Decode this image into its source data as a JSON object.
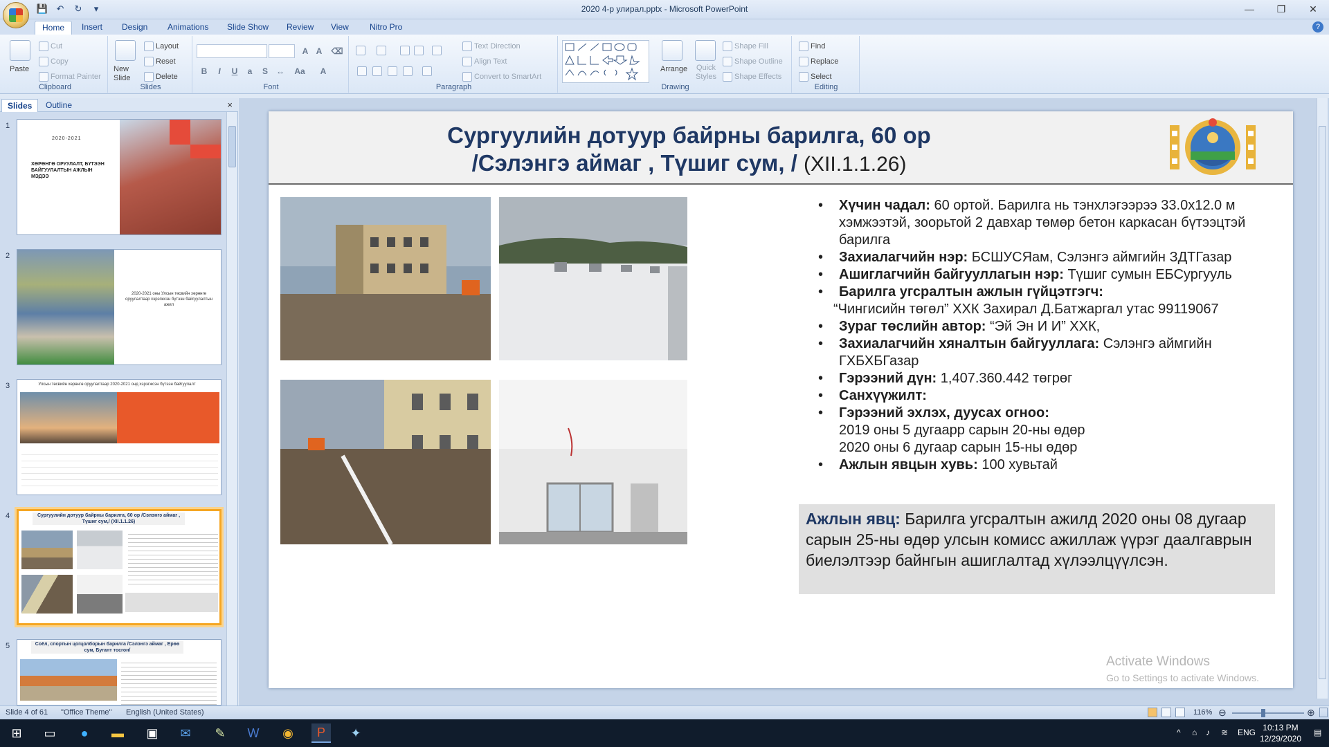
{
  "app": {
    "title": "2020 4-р улирал.pptx - Microsoft PowerPoint",
    "minimize": "—",
    "restore": "❐",
    "close": "✕"
  },
  "tabs": [
    "Home",
    "Insert",
    "Design",
    "Animations",
    "Slide Show",
    "Review",
    "View",
    "Nitro Pro"
  ],
  "ribbon": {
    "clipboard": {
      "label": "Clipboard",
      "paste": "Paste",
      "cut": "Cut",
      "copy": "Copy",
      "format_painter": "Format Painter"
    },
    "slides": {
      "label": "Slides",
      "new_slide": "New Slide",
      "layout": "Layout",
      "reset": "Reset",
      "delete": "Delete"
    },
    "font": {
      "label": "Font"
    },
    "paragraph": {
      "label": "Paragraph",
      "text_direction": "Text Direction",
      "align_text": "Align Text",
      "convert_smartart": "Convert to SmartArt"
    },
    "drawing": {
      "label": "Drawing",
      "arrange": "Arrange",
      "quick_styles": "Quick Styles",
      "shape_fill": "Shape Fill",
      "shape_outline": "Shape Outline",
      "shape_effects": "Shape Effects"
    },
    "editing": {
      "label": "Editing",
      "find": "Find",
      "replace": "Replace",
      "select": "Select"
    }
  },
  "left_pane": {
    "tab_slides": "Slides",
    "tab_outline": "Outline",
    "close": "×",
    "thumbs": [
      {
        "num": "1",
        "year": "2020-2021",
        "text": "ХӨРӨНГӨ ОРУУЛАЛТ, БҮТЭЭН БАЙГУУЛАЛТЫН АЖЛЫН МЭДЭЭ"
      },
      {
        "num": "2",
        "text": "2020-2021 оны Улсын төсвийн хөрөнгө оруулалтаар хэрэгжсэн бүтээн байгуулалтын ажил"
      },
      {
        "num": "3",
        "text": "Улсын төсвийн хөрөнгө оруулалтаар 2020-2021 онд хэрэгжсэн бүтээн байгуулалт"
      },
      {
        "num": "4",
        "title": "Сургуулийн дотуур байрны барилга, 60 ор /Сэлэнгэ аймаг , Түшиг сум,/ (XII.1.1.26)"
      },
      {
        "num": "5",
        "title": "Соёл, спортын цогцолборын барилга /Сэлэнгэ аймаг , Ерөө сум, Бугант тосгон/"
      }
    ]
  },
  "slide": {
    "title_line1": "Сургуулийн дотуур байрны барилга, 60 ор",
    "title_line2": "/Сэлэнгэ аймаг , Түшиг сум, /",
    "title_code": "(XII.1.1.26)",
    "bullets": [
      {
        "label": "Хүчин чадал:",
        "text": " 60 ортой. Барилга нь тэнхлэгээрээ 33.0x12.0 м хэмжээтэй, зоорьтой 2 давхар төмөр бетон каркасан бүтээцтэй барилга"
      },
      {
        "label": "Захиалагчийн нэр:",
        "text": " БСШУСЯам, Сэлэнгэ аймгийн ЗДТГазар"
      },
      {
        "label": "Ашиглагчийн байгууллагын нэр:",
        "text": " Түшиг сумын ЕБСургууль"
      },
      {
        "label": "Барилга угсралтын ажлын гүйцэтгэгч:",
        "text": ""
      }
    ],
    "contractor_line": "“Чингисийн төгөл” ХХК Захирал Д.Батжаргал утас 99119067",
    "bullets2": [
      {
        "label": "Зураг төслийн автор:",
        "text": " “Эй Эн И И” ХХК,"
      },
      {
        "label": "Захиалагчийн хяналтын байгууллага:",
        "text": " Сэлэнгэ аймгийн ГХБХБГазар"
      },
      {
        "label": "Гэрээний дүн:",
        "text": " 1,407.360.442 төгрөг"
      },
      {
        "label": "Санхүүжилт:",
        "text": ""
      },
      {
        "label": "Гэрээний эхлэх, дуусах огноо:",
        "text": ""
      }
    ],
    "date_line1": "2019 оны 5 дугаарр сарын 20-ны өдөр",
    "date_line2": "2020 оны 6 дугаар сарын 15-ны өдөр",
    "bullet_last": {
      "label": "Ажлын явцын хувь:",
      "text": " 100 хувьтай"
    },
    "progress_label": "Ажлын явц:",
    "progress_text": " Барилга угсралтын ажилд 2020 оны 08 дугаар сарын 25-ны өдөр улсын комисс ажиллаж үүрэг даалгаврын биелэлтээр байнгын ашиглалтад хүлээлцүүлсэн.",
    "watermark_1": "Activate Windows",
    "watermark_2": "Go to Settings to activate Windows."
  },
  "status": {
    "slide_num": "Slide 4 of 61",
    "theme": "\"Office Theme\"",
    "language": "English (United States)",
    "zoom": "116%"
  },
  "taskbar": {
    "lang": "ENG",
    "time": "10:13 PM",
    "date": "12/29/2020"
  },
  "colors": {
    "title_blue": "#1f3864",
    "accent_orange": "#f5a623"
  }
}
